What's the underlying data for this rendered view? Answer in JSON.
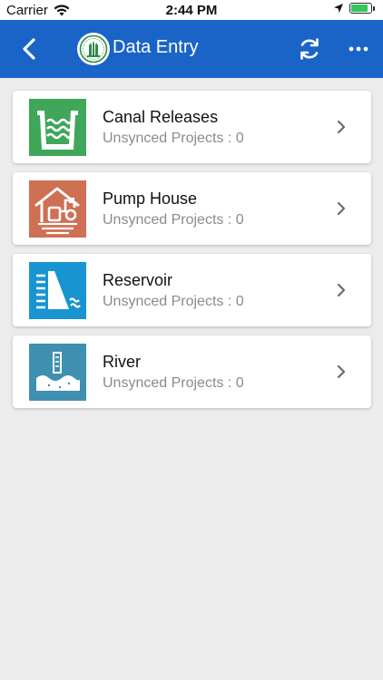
{
  "statusbar": {
    "carrier": "Carrier",
    "time": "2:44 PM",
    "battery_level": 0.85,
    "icons": [
      "wifi-icon",
      "location-arrow-icon",
      "battery-charging-icon"
    ]
  },
  "appbar": {
    "title": "Data Entry",
    "color": "#1a64c8",
    "icons": [
      "back-chevron-icon",
      "emblem-logo-icon",
      "sync-icon",
      "more-dots-icon"
    ]
  },
  "items": [
    {
      "title": "Canal Releases",
      "subtitle": "Unsynced Projects : 0",
      "icon": "canal-icon",
      "icon_color": "#3fa65a"
    },
    {
      "title": "Pump House",
      "subtitle": "Unsynced Projects : 0",
      "icon": "pump-house-icon",
      "icon_color": "#cf6f53"
    },
    {
      "title": "Reservoir",
      "subtitle": "Unsynced Projects : 0",
      "icon": "reservoir-icon",
      "icon_color": "#1895d0"
    },
    {
      "title": "River",
      "subtitle": "Unsynced Projects : 0",
      "icon": "river-icon",
      "icon_color": "#3f8fb0"
    }
  ]
}
